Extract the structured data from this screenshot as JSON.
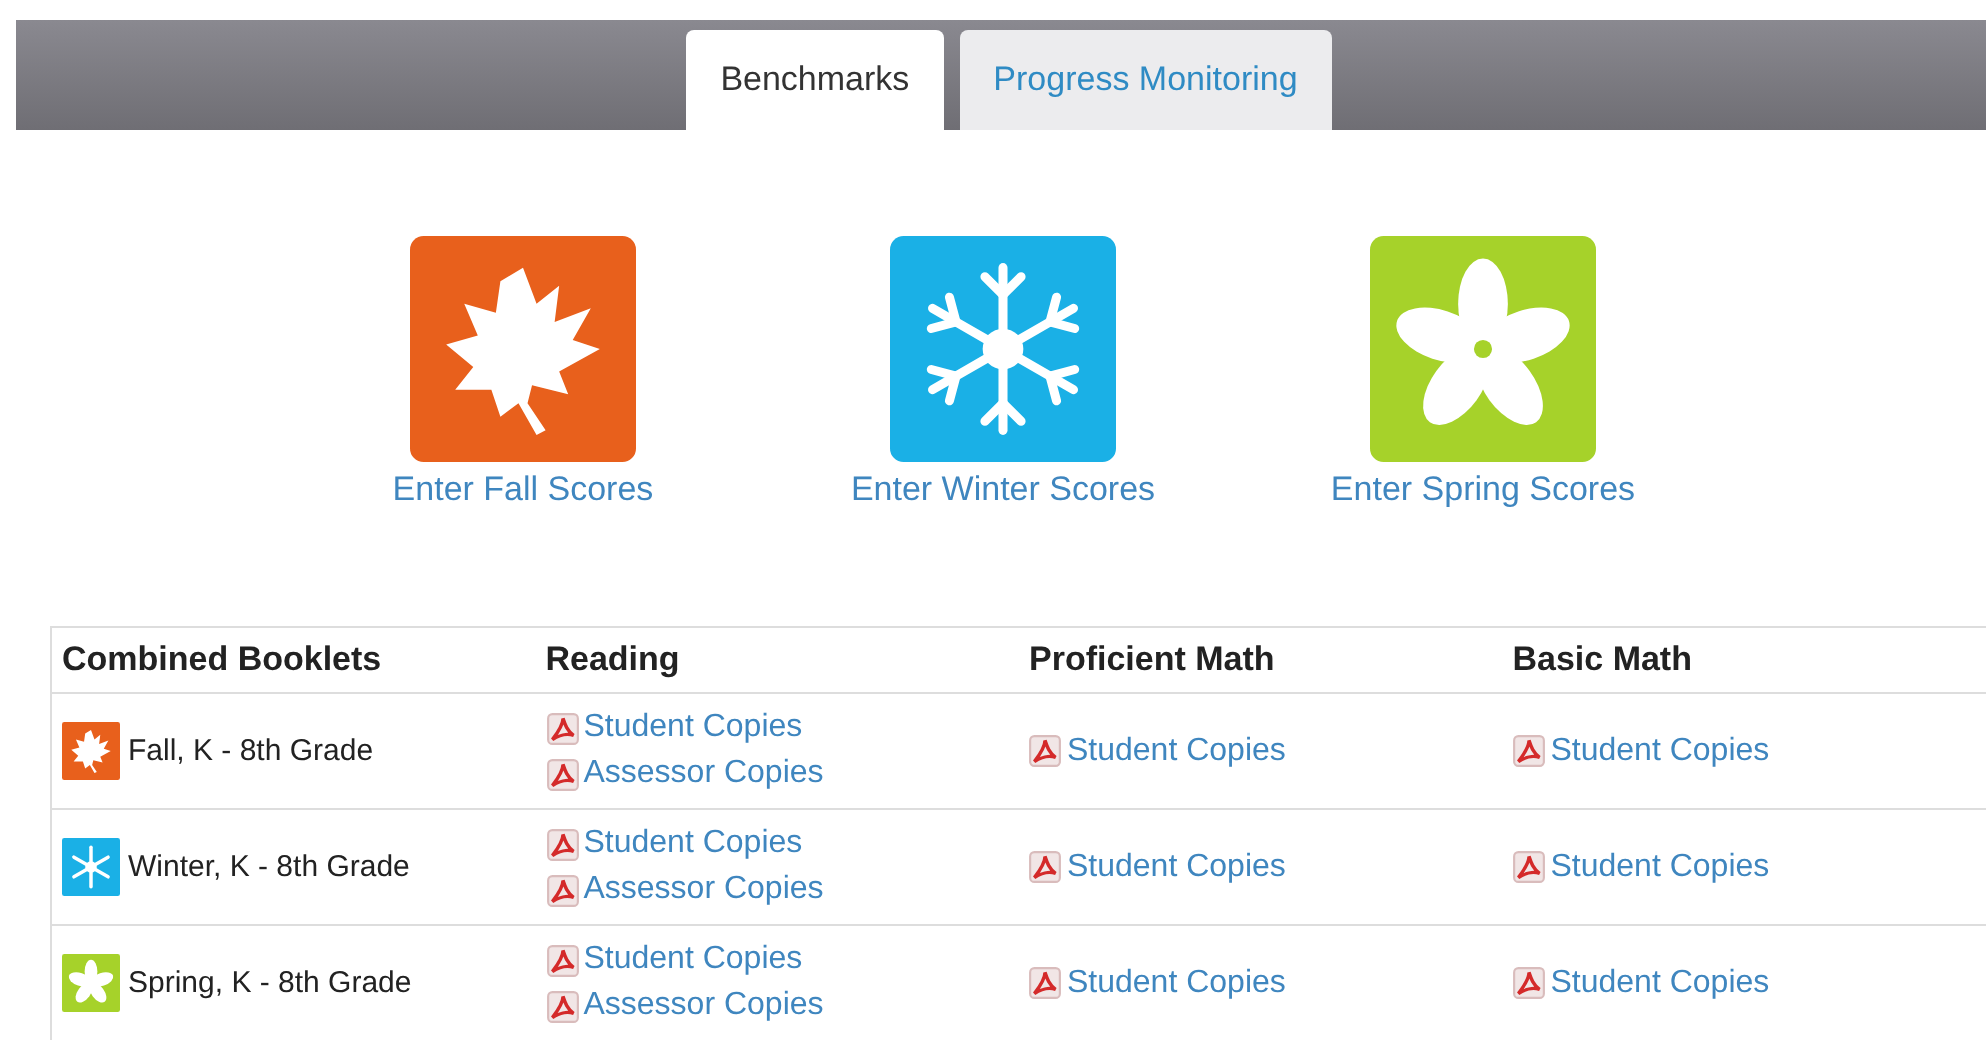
{
  "tabs": [
    {
      "label": "Benchmarks",
      "selected": true
    },
    {
      "label": "Progress Monitoring",
      "selected": false
    }
  ],
  "seasons": [
    {
      "kind": "fall",
      "color": "#e8601c",
      "label": "Enter Fall Scores"
    },
    {
      "kind": "winter",
      "color": "#1ab0e6",
      "label": "Enter Winter Scores"
    },
    {
      "kind": "spring",
      "color": "#a6d22a",
      "label": "Enter Spring Scores"
    }
  ],
  "table": {
    "columns": [
      "Combined Booklets",
      "Reading",
      "Proficient Math",
      "Basic Math"
    ],
    "rows": [
      {
        "kind": "fall",
        "color": "#e8601c",
        "name": "Fall, K - 8th Grade",
        "reading": [
          "Student Copies",
          "Assessor Copies"
        ],
        "proficient_math": [
          "Student Copies"
        ],
        "basic_math": [
          "Student Copies"
        ]
      },
      {
        "kind": "winter",
        "color": "#1ab0e6",
        "name": "Winter, K - 8th Grade",
        "reading": [
          "Student Copies",
          "Assessor Copies"
        ],
        "proficient_math": [
          "Student Copies"
        ],
        "basic_math": [
          "Student Copies"
        ]
      },
      {
        "kind": "spring",
        "color": "#a6d22a",
        "name": "Spring, K - 8th Grade",
        "reading": [
          "Student Copies",
          "Assessor Copies"
        ],
        "proficient_math": [
          "Student Copies"
        ],
        "basic_math": [
          "Student Copies"
        ]
      }
    ]
  }
}
